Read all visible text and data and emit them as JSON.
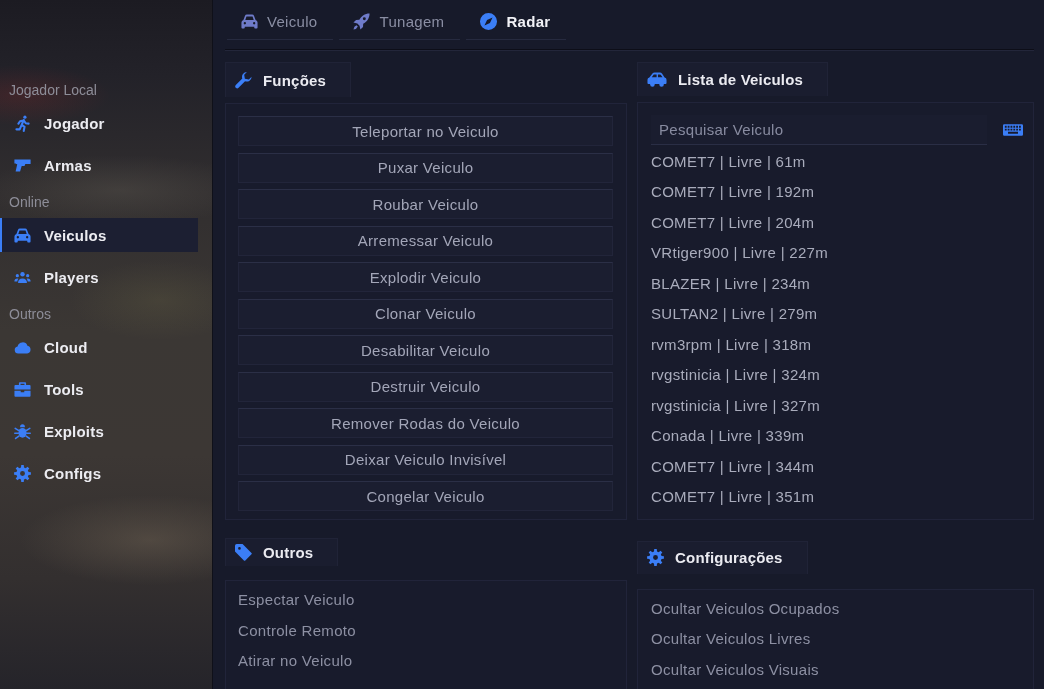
{
  "sidebar": {
    "sections": [
      {
        "title": "Jogador Local",
        "items": [
          {
            "label": "Jogador",
            "selected": false
          },
          {
            "label": "Armas",
            "selected": false
          }
        ]
      },
      {
        "title": "Online",
        "items": [
          {
            "label": "Veiculos",
            "selected": true
          },
          {
            "label": "Players",
            "selected": false
          }
        ]
      },
      {
        "title": "Outros",
        "items": [
          {
            "label": "Cloud",
            "selected": false
          },
          {
            "label": "Tools",
            "selected": false
          },
          {
            "label": "Exploits",
            "selected": false
          },
          {
            "label": "Configs",
            "selected": false
          }
        ]
      }
    ]
  },
  "tabs": [
    {
      "label": "Veiculo",
      "selected": false
    },
    {
      "label": "Tunagem",
      "selected": false
    },
    {
      "label": "Radar",
      "selected": true
    }
  ],
  "functions": {
    "title": "Funções",
    "buttons": [
      "Teleportar no Veiculo",
      "Puxar Veiculo",
      "Roubar Veiculo",
      "Arremessar Veiculo",
      "Explodir Veiculo",
      "Clonar Veiculo",
      "Desabilitar Veiculo",
      "Destruir Veiculo",
      "Remover Rodas do Veiculo",
      "Deixar Veiculo Invisível",
      "Congelar Veiculo"
    ]
  },
  "vehicle_list": {
    "title": "Lista de Veiculos",
    "search": {
      "placeholder": "Pesquisar Veiculo"
    },
    "items": [
      "COMET7 | Livre | 61m",
      "COMET7 | Livre | 192m",
      "COMET7 | Livre | 204m",
      "VRtiger900 | Livre | 227m",
      "BLAZER | Livre | 234m",
      "SULTAN2 | Livre | 279m",
      "rvm3rpm | Livre | 318m",
      "rvgstinicia | Livre | 324m",
      "rvgstinicia | Livre | 327m",
      "Conada | Livre | 339m",
      "COMET7 | Livre | 344m",
      "COMET7 | Livre | 351m"
    ]
  },
  "others": {
    "title": "Outros",
    "items": [
      "Espectar Veiculo",
      "Controle Remoto",
      "Atirar no Veiculo"
    ]
  },
  "settings": {
    "title": "Configurações",
    "items": [
      "Ocultar Veiculos Ocupados",
      "Ocultar Veiculos Livres",
      "Ocultar Veiculos Visuais"
    ]
  }
}
